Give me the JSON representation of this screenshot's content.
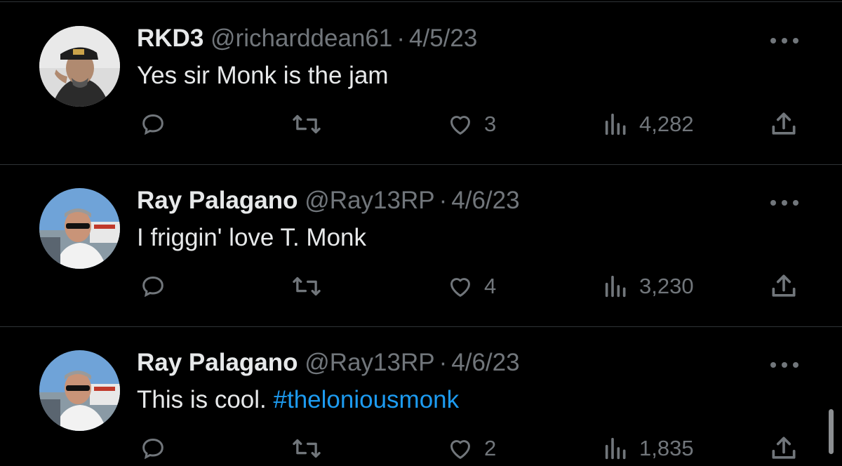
{
  "colors": {
    "background": "#000000",
    "text": "#e7e9ea",
    "muted": "#71767b",
    "link": "#1d9bf0",
    "divider": "#2f3336"
  },
  "icons": {
    "reply": "speech-bubble-icon",
    "retweet": "retweet-arrows-icon",
    "like": "heart-icon",
    "views": "bar-chart-icon",
    "share": "share-upload-icon",
    "more": "ellipsis-icon"
  },
  "tweets": [
    {
      "name": "RKD3",
      "handle": "@richarddean61",
      "separator": "·",
      "date": "4/5/23",
      "text": "Yes sir Monk is the jam",
      "hashtag": "",
      "likes": "3",
      "views": "4,282"
    },
    {
      "name": "Ray Palagano",
      "handle": "@Ray13RP",
      "separator": "·",
      "date": "4/6/23",
      "text": "I friggin' love T. Monk",
      "hashtag": "",
      "likes": "4",
      "views": "3,230"
    },
    {
      "name": "Ray Palagano",
      "handle": "@Ray13RP",
      "separator": "·",
      "date": "4/6/23",
      "text": "This is cool. ",
      "hashtag": "#theloniousmonk",
      "likes": "2",
      "views": "1,835"
    }
  ]
}
